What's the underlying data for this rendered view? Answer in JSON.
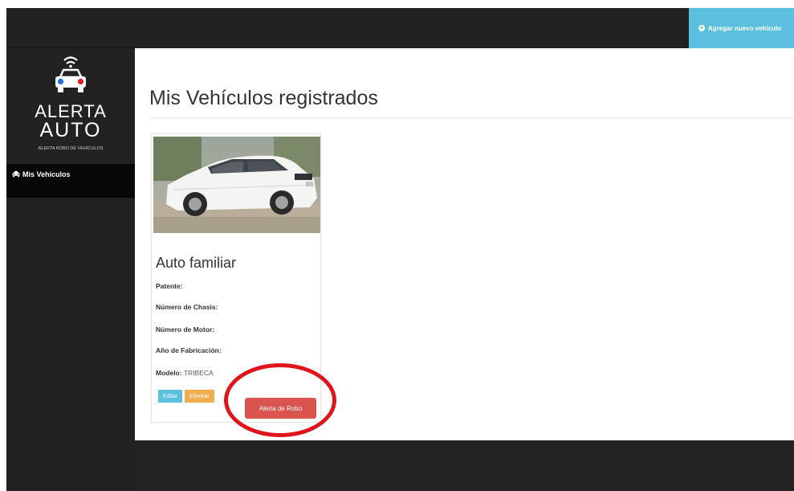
{
  "topbar": {
    "add_vehicle_label": "Agregar nuevo vehículo",
    "add_icon": "plus-circle-icon"
  },
  "sidebar": {
    "logo": {
      "line1": "ALERTA",
      "line2": "AUTO",
      "tagline": "ALERTA ROBO DE VEHÍCULOS"
    },
    "items": [
      {
        "label": "Mis Vehículos",
        "icon": "car-icon",
        "active": true
      }
    ]
  },
  "main": {
    "page_title": "Mis Vehículos registrados",
    "vehicles": [
      {
        "name": "Auto familiar",
        "fields": {
          "patente_label": "Patente:",
          "patente_value": "",
          "chasis_label": "Número de Chasis:",
          "chasis_value": "",
          "motor_label": "Número de Motor:",
          "motor_value": "",
          "anio_label": "Año de Fabricación:",
          "anio_value": "",
          "modelo_label": "Modelo:",
          "modelo_value": "TRIBECA"
        },
        "actions": {
          "edit_label": "Editar",
          "delete_label": "Eliminar",
          "alert_label": "Alerta de Robo"
        }
      }
    ]
  },
  "colors": {
    "info": "#5bc0de",
    "warning": "#f0ad4e",
    "danger": "#d9534f",
    "highlight": "#e0141b",
    "dark_bg": "#222222"
  }
}
